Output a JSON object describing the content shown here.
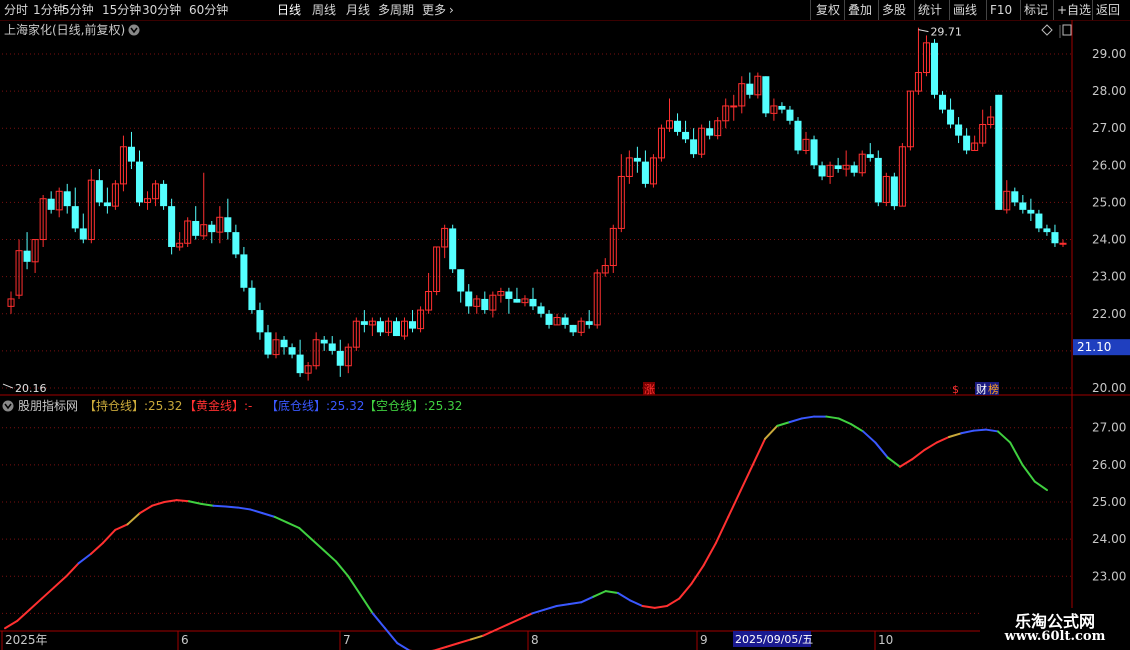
{
  "toolbar": {
    "left_items": [
      {
        "label": "分时"
      },
      {
        "label": "1分钟"
      },
      {
        "label": "5分钟"
      },
      {
        "label": "15分钟"
      },
      {
        "label": "30分钟"
      },
      {
        "label": "60分钟"
      },
      {
        "label": "日线",
        "active": true
      },
      {
        "label": "周线"
      },
      {
        "label": "月线"
      },
      {
        "label": "多周期"
      },
      {
        "label": "更多"
      }
    ],
    "right_items": [
      {
        "label": "复权"
      },
      {
        "label": "叠加"
      },
      {
        "label": "多股"
      },
      {
        "label": "统计"
      },
      {
        "label": "画线"
      },
      {
        "label": "F10"
      },
      {
        "label": "标记"
      },
      {
        "label": "+自选"
      },
      {
        "label": "返回"
      }
    ]
  },
  "price_panel": {
    "title": "上海家化(日线,前复权)",
    "current_price_label": "21.10",
    "high_label": "29.71",
    "low_label": "20.16",
    "markers": [
      {
        "text": "涨",
        "color": "#ff3030",
        "bg": "#7a0000"
      },
      {
        "text": "$",
        "color": "#ff3030"
      },
      {
        "text": "财",
        "color": "#ffffff",
        "bg": "#1a1a80"
      },
      {
        "text": "榜",
        "color": "#ffa020",
        "bg": "#1a1a80"
      }
    ]
  },
  "indicator_panel": {
    "title": "股朋指标网",
    "legend": [
      {
        "text": "【持仓线】:25.32",
        "color": "#c9a93a"
      },
      {
        "text": "【黄金线】:-",
        "color": "#ff3030"
      },
      {
        "text": "【底仓线】:25.32",
        "color": "#3a58ff"
      },
      {
        "text": "【空仓线】:25.32",
        "color": "#40d040"
      }
    ]
  },
  "date_axis": {
    "labels": [
      "2025年",
      "6",
      "7",
      "8",
      "9",
      "2025/09/05/五",
      "10"
    ]
  },
  "watermark": {
    "line1": "乐淘公式网",
    "line2": "www.60lt.com"
  },
  "colors": {
    "up": "#ff3030",
    "down": "#54ffff",
    "grid": "#7a1010",
    "axis": "#a00000",
    "hold": "#c9a93a",
    "gold": "#ff3030",
    "base": "#3a58ff",
    "empty": "#40d040"
  },
  "chart_data": [
    {
      "type": "candlestick",
      "title": "上海家化(日线,前复权)",
      "ylim": [
        20.0,
        29.7
      ],
      "y_ticks": [
        20.0,
        21.0,
        22.0,
        23.0,
        24.0,
        25.0,
        26.0,
        27.0,
        28.0,
        29.0
      ],
      "x_labels": [
        "2025年",
        "6",
        "7",
        "8",
        "9",
        "2025/09/05/五",
        "10"
      ],
      "high": 29.71,
      "low": 20.16,
      "last": 21.1,
      "ohlc": [
        [
          22.2,
          22.6,
          22.0,
          22.4
        ],
        [
          22.5,
          24.0,
          22.4,
          23.7
        ],
        [
          23.7,
          24.2,
          23.2,
          23.4
        ],
        [
          23.4,
          24.0,
          23.1,
          24.0
        ],
        [
          24.0,
          25.2,
          23.8,
          25.1
        ],
        [
          25.1,
          25.3,
          24.7,
          24.8
        ],
        [
          24.8,
          25.4,
          24.6,
          25.3
        ],
        [
          25.3,
          25.5,
          24.7,
          24.9
        ],
        [
          24.9,
          25.4,
          24.2,
          24.3
        ],
        [
          24.3,
          24.7,
          23.9,
          24.0
        ],
        [
          24.0,
          25.9,
          23.9,
          25.6
        ],
        [
          25.6,
          25.9,
          24.9,
          25.0
        ],
        [
          25.0,
          25.4,
          24.7,
          24.9
        ],
        [
          24.9,
          25.6,
          24.8,
          25.5
        ],
        [
          25.5,
          26.8,
          25.3,
          26.5
        ],
        [
          26.5,
          26.9,
          25.9,
          26.1
        ],
        [
          26.1,
          26.4,
          24.9,
          25.0
        ],
        [
          25.0,
          25.3,
          24.8,
          25.1
        ],
        [
          25.1,
          25.6,
          24.9,
          25.5
        ],
        [
          25.5,
          25.6,
          24.8,
          24.9
        ],
        [
          24.9,
          25.1,
          23.6,
          23.8
        ],
        [
          23.8,
          24.2,
          23.7,
          23.9
        ],
        [
          23.9,
          24.6,
          23.8,
          24.5
        ],
        [
          24.5,
          24.9,
          24.0,
          24.1
        ],
        [
          24.1,
          25.8,
          24.0,
          24.4
        ],
        [
          24.4,
          24.5,
          23.9,
          24.2
        ],
        [
          24.2,
          24.9,
          23.9,
          24.6
        ],
        [
          24.6,
          25.1,
          24.0,
          24.2
        ],
        [
          24.2,
          24.4,
          23.5,
          23.6
        ],
        [
          23.6,
          23.8,
          22.6,
          22.7
        ],
        [
          22.7,
          22.9,
          22.0,
          22.1
        ],
        [
          22.1,
          22.3,
          21.3,
          21.5
        ],
        [
          21.5,
          21.7,
          20.8,
          20.9
        ],
        [
          20.9,
          21.5,
          20.8,
          21.3
        ],
        [
          21.3,
          21.4,
          20.9,
          21.1
        ],
        [
          21.1,
          21.2,
          20.8,
          20.9
        ],
        [
          20.9,
          21.3,
          20.3,
          20.4
        ],
        [
          20.4,
          20.7,
          20.2,
          20.6
        ],
        [
          20.6,
          21.5,
          20.5,
          21.3
        ],
        [
          21.3,
          21.4,
          21.0,
          21.2
        ],
        [
          21.2,
          21.4,
          20.9,
          21.0
        ],
        [
          21.0,
          21.3,
          20.3,
          20.6
        ],
        [
          20.6,
          21.2,
          20.4,
          21.1
        ],
        [
          21.1,
          21.9,
          21.0,
          21.8
        ],
        [
          21.8,
          22.1,
          21.5,
          21.7
        ],
        [
          21.7,
          21.9,
          21.4,
          21.8
        ],
        [
          21.8,
          21.9,
          21.4,
          21.5
        ],
        [
          21.5,
          21.9,
          21.4,
          21.8
        ],
        [
          21.8,
          21.9,
          21.4,
          21.4
        ],
        [
          21.4,
          21.9,
          21.3,
          21.8
        ],
        [
          21.8,
          22.1,
          21.5,
          21.6
        ],
        [
          21.6,
          22.2,
          21.5,
          22.1
        ],
        [
          22.1,
          23.1,
          22.0,
          22.6
        ],
        [
          22.6,
          23.8,
          22.5,
          23.8
        ],
        [
          23.8,
          24.4,
          23.5,
          24.3
        ],
        [
          24.3,
          24.4,
          23.1,
          23.2
        ],
        [
          23.2,
          23.2,
          22.3,
          22.6
        ],
        [
          22.6,
          22.8,
          22.0,
          22.2
        ],
        [
          22.2,
          22.5,
          22.0,
          22.4
        ],
        [
          22.4,
          22.6,
          22.0,
          22.1
        ],
        [
          22.1,
          22.6,
          21.9,
          22.5
        ],
        [
          22.5,
          22.7,
          22.3,
          22.6
        ],
        [
          22.6,
          22.7,
          22.0,
          22.4
        ],
        [
          22.4,
          22.7,
          22.3,
          22.3
        ],
        [
          22.3,
          22.5,
          22.2,
          22.4
        ],
        [
          22.4,
          22.7,
          22.1,
          22.2
        ],
        [
          22.2,
          22.3,
          21.9,
          22.0
        ],
        [
          22.0,
          22.1,
          21.6,
          21.7
        ],
        [
          21.7,
          22.0,
          21.7,
          21.9
        ],
        [
          21.9,
          22.0,
          21.6,
          21.7
        ],
        [
          21.7,
          21.7,
          21.4,
          21.5
        ],
        [
          21.5,
          21.9,
          21.4,
          21.8
        ],
        [
          21.8,
          22.1,
          21.6,
          21.7
        ],
        [
          21.7,
          23.2,
          21.6,
          23.1
        ],
        [
          23.1,
          23.5,
          23.0,
          23.3
        ],
        [
          23.3,
          24.4,
          23.1,
          24.3
        ],
        [
          24.3,
          26.3,
          24.2,
          25.7
        ],
        [
          25.7,
          26.4,
          25.5,
          26.2
        ],
        [
          26.2,
          26.5,
          25.8,
          26.1
        ],
        [
          26.1,
          26.4,
          25.4,
          25.5
        ],
        [
          25.5,
          26.3,
          25.4,
          26.2
        ],
        [
          26.2,
          27.1,
          26.1,
          27.0
        ],
        [
          27.0,
          27.8,
          26.9,
          27.2
        ],
        [
          27.2,
          27.4,
          26.8,
          26.9
        ],
        [
          26.9,
          27.2,
          26.6,
          26.7
        ],
        [
          26.7,
          27.0,
          26.2,
          26.3
        ],
        [
          26.3,
          27.1,
          26.2,
          27.0
        ],
        [
          27.0,
          27.2,
          26.7,
          26.8
        ],
        [
          26.8,
          27.3,
          26.7,
          27.2
        ],
        [
          27.2,
          27.8,
          27.0,
          27.6
        ],
        [
          27.6,
          27.9,
          27.2,
          27.6
        ],
        [
          27.6,
          28.4,
          27.4,
          28.2
        ],
        [
          28.2,
          28.5,
          27.8,
          27.9
        ],
        [
          27.9,
          28.5,
          27.8,
          28.4
        ],
        [
          28.4,
          28.4,
          27.3,
          27.4
        ],
        [
          27.4,
          27.8,
          27.2,
          27.6
        ],
        [
          27.6,
          27.7,
          27.4,
          27.5
        ],
        [
          27.5,
          27.6,
          27.1,
          27.2
        ],
        [
          27.2,
          27.3,
          26.3,
          26.4
        ],
        [
          26.4,
          26.9,
          26.3,
          26.7
        ],
        [
          26.7,
          26.8,
          25.9,
          26.0
        ],
        [
          26.0,
          26.1,
          25.6,
          25.7
        ],
        [
          25.7,
          26.1,
          25.5,
          26.0
        ],
        [
          26.0,
          26.2,
          25.8,
          25.9
        ],
        [
          25.9,
          26.4,
          25.7,
          26.0
        ],
        [
          26.0,
          26.1,
          25.7,
          25.8
        ],
        [
          25.8,
          26.4,
          25.7,
          26.3
        ],
        [
          26.3,
          26.6,
          26.1,
          26.2
        ],
        [
          26.2,
          26.4,
          24.9,
          25.0
        ],
        [
          25.0,
          25.8,
          24.9,
          25.7
        ],
        [
          25.7,
          25.8,
          24.8,
          24.9
        ],
        [
          24.9,
          26.6,
          24.9,
          26.5
        ],
        [
          26.5,
          28.0,
          26.4,
          28.0
        ],
        [
          28.0,
          29.71,
          27.9,
          28.5
        ],
        [
          28.5,
          29.5,
          28.4,
          29.3
        ],
        [
          29.3,
          29.4,
          27.8,
          27.9
        ],
        [
          27.9,
          28.0,
          27.4,
          27.5
        ],
        [
          27.5,
          27.8,
          27.0,
          27.1
        ],
        [
          27.1,
          27.3,
          26.6,
          26.8
        ],
        [
          26.8,
          27.0,
          26.3,
          26.4
        ],
        [
          26.4,
          26.8,
          26.4,
          26.6
        ],
        [
          26.6,
          27.5,
          26.5,
          27.1
        ],
        [
          27.1,
          27.6,
          27.0,
          27.3
        ],
        [
          27.9,
          27.9,
          24.8,
          24.8
        ],
        [
          24.8,
          25.6,
          24.7,
          25.3
        ],
        [
          25.3,
          25.4,
          24.9,
          25.0
        ],
        [
          25.0,
          25.2,
          24.7,
          24.8
        ],
        [
          24.8,
          25.1,
          24.5,
          24.7
        ],
        [
          24.7,
          24.8,
          24.2,
          24.3
        ],
        [
          24.3,
          24.4,
          24.1,
          24.2
        ],
        [
          24.2,
          24.4,
          23.8,
          23.9
        ],
        [
          23.9,
          24.0,
          23.8,
          23.9
        ]
      ]
    },
    {
      "type": "line",
      "title": "股朋指标网",
      "ylim": [
        21.5,
        27.8
      ],
      "y_ticks": [
        22.0,
        23.0,
        24.0,
        25.0,
        26.0,
        27.0
      ],
      "series": [
        {
          "name": "【持仓线】",
          "last": 25.32
        },
        {
          "name": "【底仓线】",
          "last": 25.32
        },
        {
          "name": "【空仓线】",
          "last": 25.32
        }
      ],
      "line_values": [
        21.6,
        21.8,
        22.1,
        22.4,
        22.7,
        23.0,
        23.35,
        23.6,
        23.9,
        24.25,
        24.4,
        24.7,
        24.9,
        25.0,
        25.05,
        25.02,
        24.95,
        24.9,
        24.88,
        24.85,
        24.8,
        24.7,
        24.6,
        24.45,
        24.3,
        24.0,
        23.7,
        23.4,
        23.0,
        22.5,
        22.0,
        21.6,
        21.2,
        21.0,
        20.95,
        21.0,
        21.1,
        21.2,
        21.3,
        21.4,
        21.55,
        21.7,
        21.85,
        22.0,
        22.1,
        22.2,
        22.25,
        22.3,
        22.45,
        22.6,
        22.55,
        22.35,
        22.2,
        22.15,
        22.2,
        22.4,
        22.8,
        23.3,
        23.9,
        24.6,
        25.3,
        26.0,
        26.7,
        27.05,
        27.15,
        27.25,
        27.3,
        27.3,
        27.25,
        27.1,
        26.9,
        26.6,
        26.2,
        25.95,
        26.15,
        26.4,
        26.6,
        26.75,
        26.85,
        26.92,
        26.95,
        26.9,
        26.6,
        26.0,
        25.55,
        25.32
      ],
      "segment_colors": [
        "red",
        "red",
        "red",
        "red",
        "red",
        "red",
        "blue",
        "red",
        "red",
        "red",
        "hold",
        "red",
        "red",
        "red",
        "red",
        "green",
        "green",
        "blue",
        "blue",
        "blue",
        "blue",
        "blue",
        "green",
        "green",
        "green",
        "green",
        "green",
        "green",
        "green",
        "green",
        "blue",
        "blue",
        "blue",
        "red",
        "red",
        "red",
        "red",
        "red",
        "hold",
        "red",
        "red",
        "red",
        "red",
        "blue",
        "blue",
        "blue",
        "blue",
        "blue",
        "green",
        "green",
        "blue",
        "blue",
        "red",
        "red",
        "red",
        "red",
        "red",
        "red",
        "red",
        "red",
        "red",
        "red",
        "hold",
        "green",
        "blue",
        "blue",
        "blue",
        "green",
        "green",
        "green",
        "blue",
        "blue",
        "green",
        "red",
        "red",
        "red",
        "red",
        "hold",
        "blue",
        "blue",
        "blue",
        "green",
        "green",
        "green",
        "green"
      ]
    }
  ]
}
